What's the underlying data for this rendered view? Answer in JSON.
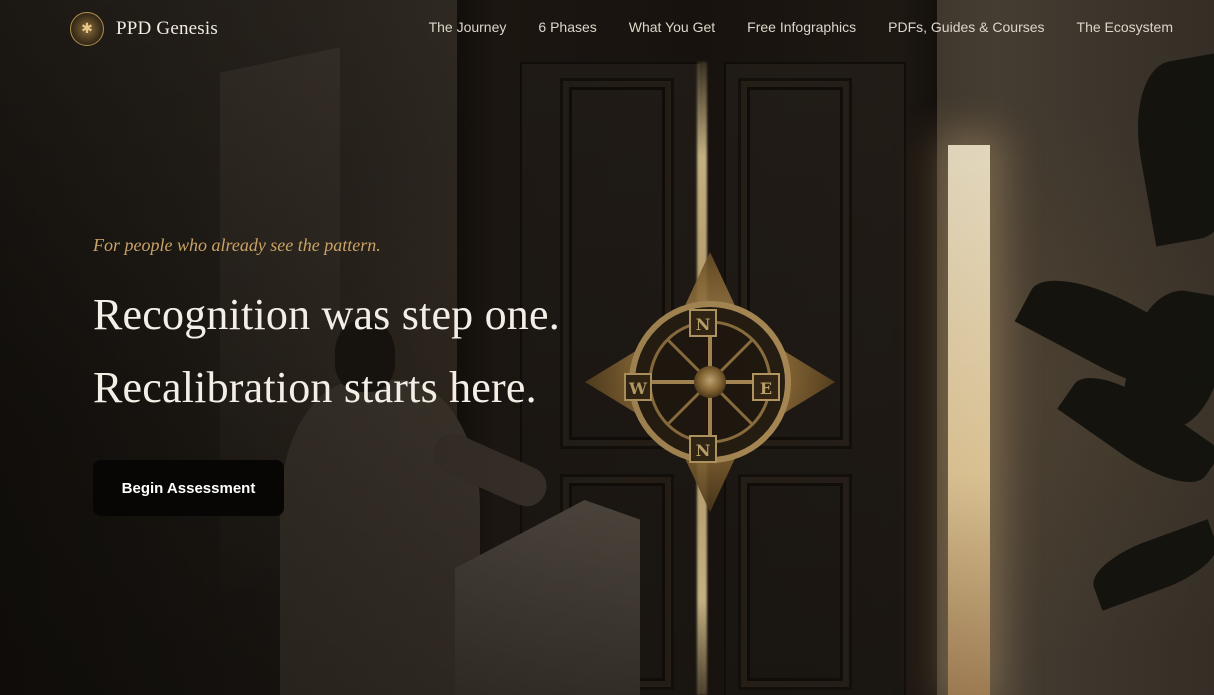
{
  "brand": {
    "name": "PPD Genesis",
    "logo_icon": "bee-emblem-icon"
  },
  "nav": {
    "links": [
      {
        "label": "The Journey"
      },
      {
        "label": "6 Phases"
      },
      {
        "label": "What You Get"
      },
      {
        "label": "Free Infographics"
      },
      {
        "label": "PDFs, Guides & Courses"
      },
      {
        "label": "The Ecosystem"
      }
    ]
  },
  "hero": {
    "eyebrow": "For people who already see the pattern.",
    "headline_line1": "Recognition was step one.",
    "headline_line2": "Recalibration starts here.",
    "cta_label": "Begin Assessment"
  },
  "compass": {
    "north": "N",
    "west": "W",
    "east": "E",
    "south": "N"
  },
  "colors": {
    "accent_gold": "#c9a266",
    "headline": "#f4efe6",
    "cta_bg": "#070605"
  }
}
